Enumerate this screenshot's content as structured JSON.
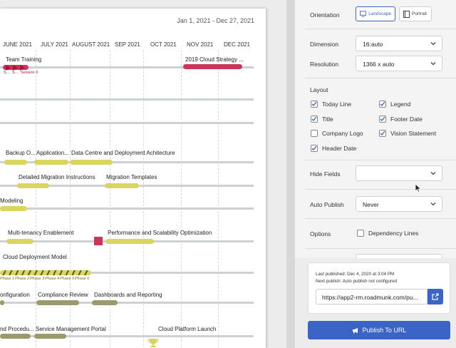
{
  "canvas": {
    "date_range": "Jan 1, 2021 - Dec 27, 2021",
    "months": [
      "JUNE 2021",
      "JULY 2021",
      "AUGUST 2021",
      "SEP 2021",
      "OCT 2021",
      "NOV 2021",
      "DEC 2021"
    ],
    "items": {
      "team_training": "Team Training",
      "team_training_sub_1": "S...",
      "team_training_sub_2": "S...",
      "team_training_sub_3": "Session 3",
      "cloud_strategy": "2019 Cloud Strategy ...",
      "backup": "Backup O...",
      "application": "Application...",
      "data_centre": "Data Centre and Deployment Achitecture",
      "detailed_migration": "Detailed Migration Instructions",
      "migration_templates": "Migration Templates",
      "modeling": "Modeling",
      "multi_tenancy": "Multi-tenancy Enablement",
      "performance": "Performance and Scalability Optimization",
      "cloud_deployment_model": "Cloud Deployment Model",
      "phases": [
        "Phase 1",
        "Phase 2",
        "Phase 3",
        "Phase 4",
        "Phase 5",
        "Phase 6"
      ],
      "configuration": "onfiguration",
      "compliance_review": "Compliance Review",
      "dashboards": "Dashboards and Reporting",
      "procedures": "nd Procedu...",
      "service_mgmt_portal": "Service Management Portal",
      "cloud_platform_launch": "Cloud Platform Launch"
    },
    "colors": {
      "yellow": "#d9d55f",
      "olive": "#9b9b6a",
      "red": "#cc3558",
      "lane": "#cdd1d6"
    }
  },
  "panel": {
    "orientation": {
      "label": "Orientation",
      "landscape": "Landscape",
      "portrait": "Portrait",
      "selected": "Landscape"
    },
    "dimension": {
      "label": "Dimension",
      "value": "16:auto"
    },
    "resolution": {
      "label": "Resolution",
      "value": "1366 x auto"
    },
    "layout": {
      "label": "Layout",
      "options": [
        {
          "label": "Today Line",
          "checked": true
        },
        {
          "label": "Legend",
          "checked": true
        },
        {
          "label": "Title",
          "checked": true
        },
        {
          "label": "Footer Date",
          "checked": true
        },
        {
          "label": "Company Logo",
          "checked": false
        },
        {
          "label": "Vision Statement",
          "checked": true
        },
        {
          "label": "Header Date",
          "checked": true
        }
      ]
    },
    "hide_fields": {
      "label": "Hide Fields",
      "value": ""
    },
    "auto_publish": {
      "label": "Auto Publish",
      "value": "Never"
    },
    "options": {
      "label": "Options",
      "dependency_lines": "Dependency Lines",
      "dependency_checked": false
    },
    "publish": {
      "last_published": "Last published: Dec 4, 2020 at 3:04 PM",
      "next_publish": "Next publish: Auto publish not configured",
      "url": "https://app2-rm.roadmunk.com/pu...",
      "button": "Publish To URL"
    },
    "accent": "#3b64c7"
  }
}
